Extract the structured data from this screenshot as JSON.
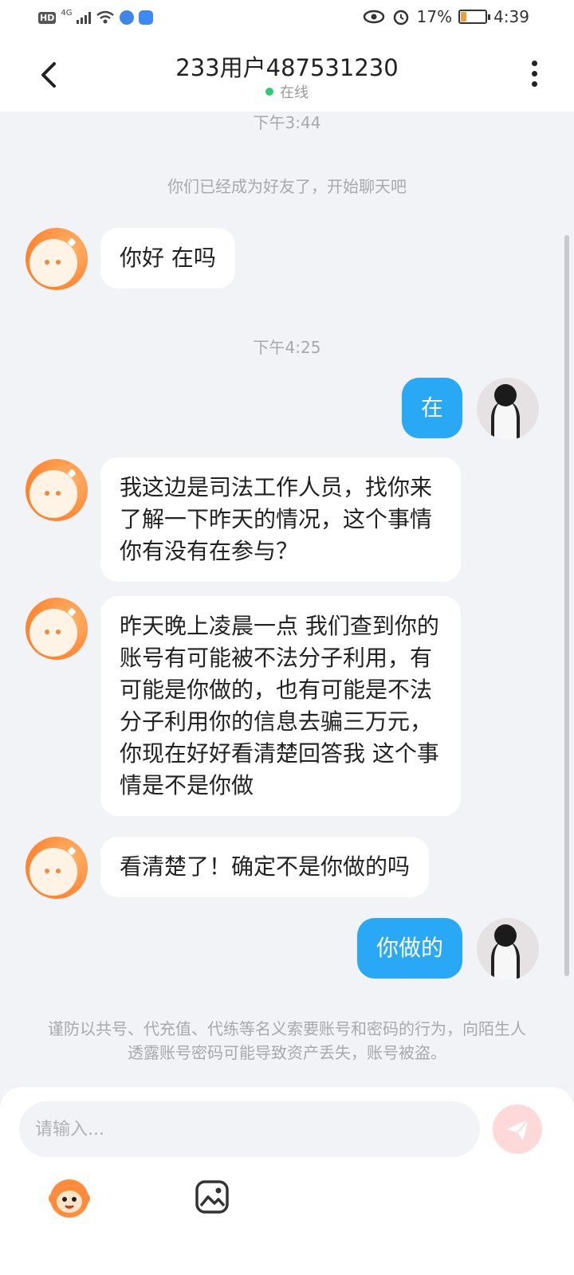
{
  "status_bar": {
    "hd": "HD",
    "network": "4G",
    "battery_percent": "17%",
    "time": "4:39"
  },
  "header": {
    "title": "233用户487531230",
    "status": "在线"
  },
  "chat": {
    "time_1": "下午3:44",
    "system_notice": "你们已经成为好友了，开始聊天吧",
    "msg_1": "你好  在吗",
    "time_2": "下午4:25",
    "msg_2": "在",
    "msg_3": "我这边是司法工作人员，找你来了解一下昨天的情况，这个事情你有没有在参与？",
    "msg_4": "昨天晚上凌晨一点 我们查到你的账号有可能被不法分子利用，有可能是你做的，也有可能是不法分子利用你的信息去骗三万元，你现在好好看清楚回答我 这个事情是不是你做",
    "msg_5": "看清楚了！确定不是你做的吗",
    "msg_6": "你做的"
  },
  "warning": "谨防以共号、代充值、代练等名义索要账号和密码的行为，向陌生人透露账号密码可能导致资产丢失，账号被盗。",
  "input": {
    "placeholder": "请输入..."
  },
  "icons": {
    "back": "chevron-left-icon",
    "more": "more-vertical-icon",
    "send": "send-icon",
    "emoji": "emoji-icon",
    "image": "image-icon"
  },
  "colors": {
    "accent": "#29a8f5",
    "online": "#2ecc71",
    "avatar_orange": "#ff8c3a"
  }
}
